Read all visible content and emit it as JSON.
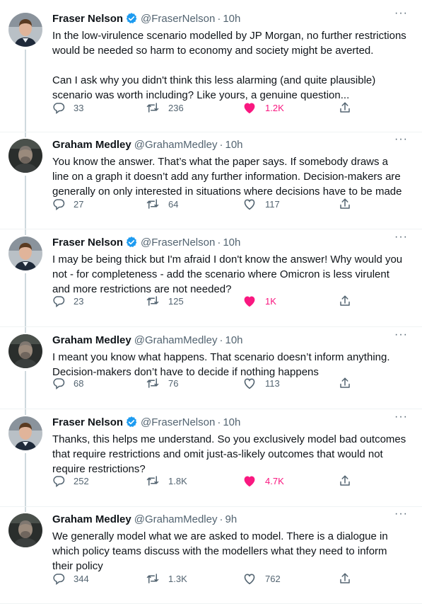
{
  "colors": {
    "accent": "#1d9bf0",
    "like": "#f91880",
    "muted": "#536471",
    "text": "#0f1419"
  },
  "tweets": [
    {
      "name": "Fraser Nelson",
      "verified": true,
      "handle": "@FraserNelson",
      "time": "10h",
      "text": "In the low-virulence scenario modelled by JP Morgan, no further restrictions would be needed so harm to economy and society might be averted.\n\nCan I ask why you didn't think this less alarming (and quite plausible) scenario was worth including? Like yours, a genuine question...",
      "replies": "33",
      "retweets": "236",
      "likes": "1.2K",
      "liked": true
    },
    {
      "name": "Graham Medley",
      "verified": false,
      "handle": "@GrahamMedley",
      "time": "10h",
      "text": "You know the answer. That’s what the paper says. If somebody draws a line on a graph it doesn’t add any further information. Decision-makers are generally on only interested in situations where decisions have to be made",
      "replies": "27",
      "retweets": "64",
      "likes": "117",
      "liked": false
    },
    {
      "name": "Fraser Nelson",
      "verified": true,
      "handle": "@FraserNelson",
      "time": "10h",
      "text": "I may be being thick but I'm afraid I don't know the answer! Why would you not - for completeness - add the scenario where Omicron is less virulent and more restrictions are not needed?",
      "replies": "23",
      "retweets": "125",
      "likes": "1K",
      "liked": true
    },
    {
      "name": "Graham Medley",
      "verified": false,
      "handle": "@GrahamMedley",
      "time": "10h",
      "text": "I meant you know what happens. That scenario doesn’t inform anything. Decision-makers don’t have to decide if nothing happens",
      "replies": "68",
      "retweets": "76",
      "likes": "113",
      "liked": false
    },
    {
      "name": "Fraser Nelson",
      "verified": true,
      "handle": "@FraserNelson",
      "time": "10h",
      "text": "Thanks, this helps me understand. So you exclusively model bad outcomes that require restrictions and omit just-as-likely outcomes that would not require restrictions?",
      "replies": "252",
      "retweets": "1.8K",
      "likes": "4.7K",
      "liked": true
    },
    {
      "name": "Graham Medley",
      "verified": false,
      "handle": "@GrahamMedley",
      "time": "9h",
      "text": "We generally model what we are asked to model. There is a dialogue in which policy teams discuss with the modellers what they need to inform their policy",
      "replies": "344",
      "retweets": "1.3K",
      "likes": "762",
      "liked": false
    }
  ]
}
